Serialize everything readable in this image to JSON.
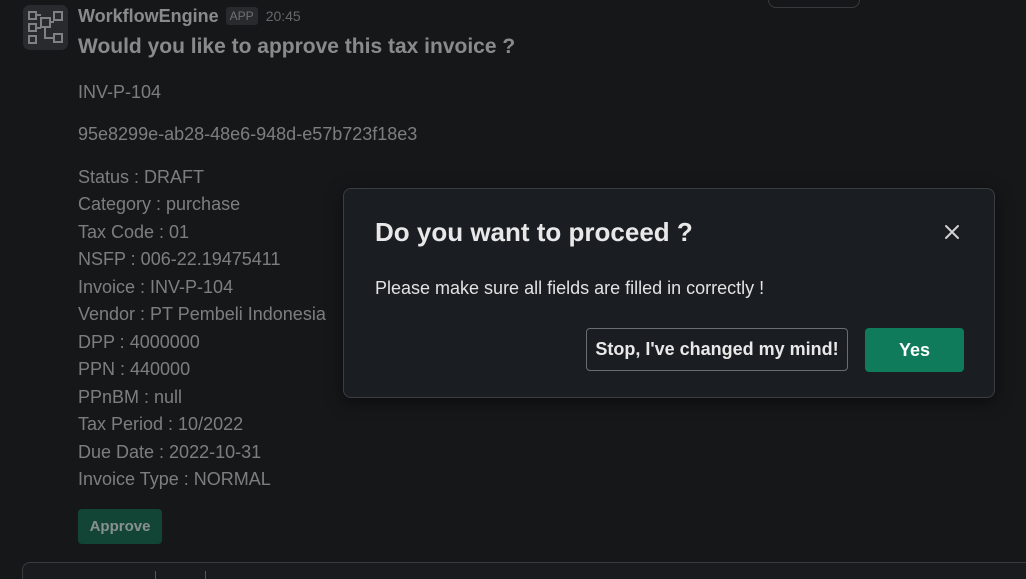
{
  "message": {
    "app_name": "WorkflowEngine",
    "badge": "APP",
    "time": "20:45",
    "question": "Would you like to approve this tax invoice ?",
    "invoice_number": "INV-P-104",
    "uuid": "95e8299e-ab28-48e6-948d-e57b723f18e3",
    "fields": [
      "Status : DRAFT",
      "Category : purchase",
      "Tax Code : 01",
      "NSFP : 006-22.19475411",
      "Invoice : INV-P-104",
      "Vendor : PT Pembeli Indonesia",
      "DPP : 4000000",
      "PPN : 440000",
      "PPnBM : null",
      "Tax Period : 10/2022",
      "Due Date : 2022-10-31",
      "Invoice Type : NORMAL"
    ],
    "approve_label": "Approve"
  },
  "dialog": {
    "title": "Do you want to proceed ?",
    "body": "Please make sure all fields are filled in correctly !",
    "cancel_label": "Stop, I've changed my mind!",
    "confirm_label": "Yes",
    "close_icon": "close-icon"
  },
  "colors": {
    "primary_button": "#0f7b5a",
    "approve_button": "#0f6b4d",
    "background": "#161719",
    "dialog_background": "#1a1d21"
  }
}
